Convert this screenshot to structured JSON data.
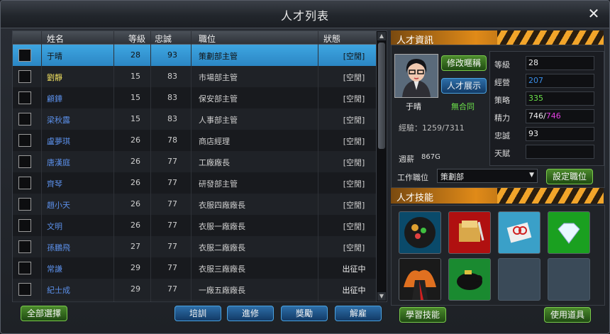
{
  "window": {
    "title": "人才列表",
    "close_label": "✕"
  },
  "table": {
    "headers": [
      "姓名",
      "等級",
      "忠誠",
      "職位",
      "狀態"
    ],
    "rows": [
      {
        "name": "于晴",
        "level": "28",
        "loyalty": "93",
        "job": "策劃部主管",
        "status": "[空閒]",
        "name_color": "white"
      },
      {
        "name": "劉靜",
        "level": "15",
        "loyalty": "83",
        "job": "市場部主管",
        "status": "[空閒]",
        "name_color": "yellow"
      },
      {
        "name": "顧鏵",
        "level": "15",
        "loyalty": "83",
        "job": "保安部主管",
        "status": "[空閒]",
        "name_color": "blue"
      },
      {
        "name": "梁秋露",
        "level": "15",
        "loyalty": "83",
        "job": "人事部主管",
        "status": "[空閒]",
        "name_color": "blue"
      },
      {
        "name": "盧夢琪",
        "level": "26",
        "loyalty": "78",
        "job": "商店經理",
        "status": "[空閒]",
        "name_color": "blue"
      },
      {
        "name": "唐漢庭",
        "level": "26",
        "loyalty": "77",
        "job": "工廠廠長",
        "status": "[空閒]",
        "name_color": "blue"
      },
      {
        "name": "齊琴",
        "level": "26",
        "loyalty": "77",
        "job": "研發部主管",
        "status": "[空閒]",
        "name_color": "blue"
      },
      {
        "name": "趙小天",
        "level": "26",
        "loyalty": "77",
        "job": "衣服四廠廠長",
        "status": "[空閒]",
        "name_color": "blue"
      },
      {
        "name": "文明",
        "level": "26",
        "loyalty": "77",
        "job": "衣服一廠廠長",
        "status": "[空閒]",
        "name_color": "blue"
      },
      {
        "name": "孫鵬飛",
        "level": "27",
        "loyalty": "77",
        "job": "衣服二廠廠長",
        "status": "[空閒]",
        "name_color": "blue"
      },
      {
        "name": "常謙",
        "level": "29",
        "loyalty": "77",
        "job": "衣服三廠廠長",
        "status": "出征中",
        "name_color": "blue"
      },
      {
        "name": "紀士成",
        "level": "29",
        "loyalty": "77",
        "job": "一廠五廠廠長",
        "status": "出征中",
        "name_color": "blue"
      }
    ]
  },
  "buttons": {
    "select_all": "全部選擇",
    "train": "培訓",
    "study": "進修",
    "reward": "獎勵",
    "dismiss": "解雇",
    "rename": "修改暱稱",
    "show": "人才展示",
    "set_job": "設定職位",
    "learn_skill": "學習技能",
    "use_item": "使用道具"
  },
  "info": {
    "header": "人才資訊",
    "name": "于晴",
    "contract": "無合同",
    "exp_label": "經驗：1259/7311",
    "salary_label": "週薪",
    "salary_value": "867G",
    "job_label": "工作職位",
    "job_value": "策劃部",
    "stats": [
      {
        "key": "等級",
        "value": "28",
        "color": "#eeeeee"
      },
      {
        "key": "經營",
        "value": "207",
        "color": "#3a8ee8"
      },
      {
        "key": "策略",
        "value": "335",
        "color": "#6be04a"
      },
      {
        "key": "精力",
        "value": "746/",
        "value2": "746",
        "color": "#eeeeee",
        "color2": "#e040e0"
      },
      {
        "key": "忠誠",
        "value": "93",
        "color": "#eeeeee"
      },
      {
        "key": "天賦",
        "value": "",
        "color": "#eeeeee"
      }
    ]
  },
  "skills": {
    "header": "人才技能",
    "icons": [
      "brain-gears-icon",
      "folder-pen-icon",
      "scissors-ribbon-icon",
      "diamond-icon",
      "businessman-fire-icon",
      "piggy-bank-icon",
      "empty-slot",
      "empty-slot"
    ]
  }
}
